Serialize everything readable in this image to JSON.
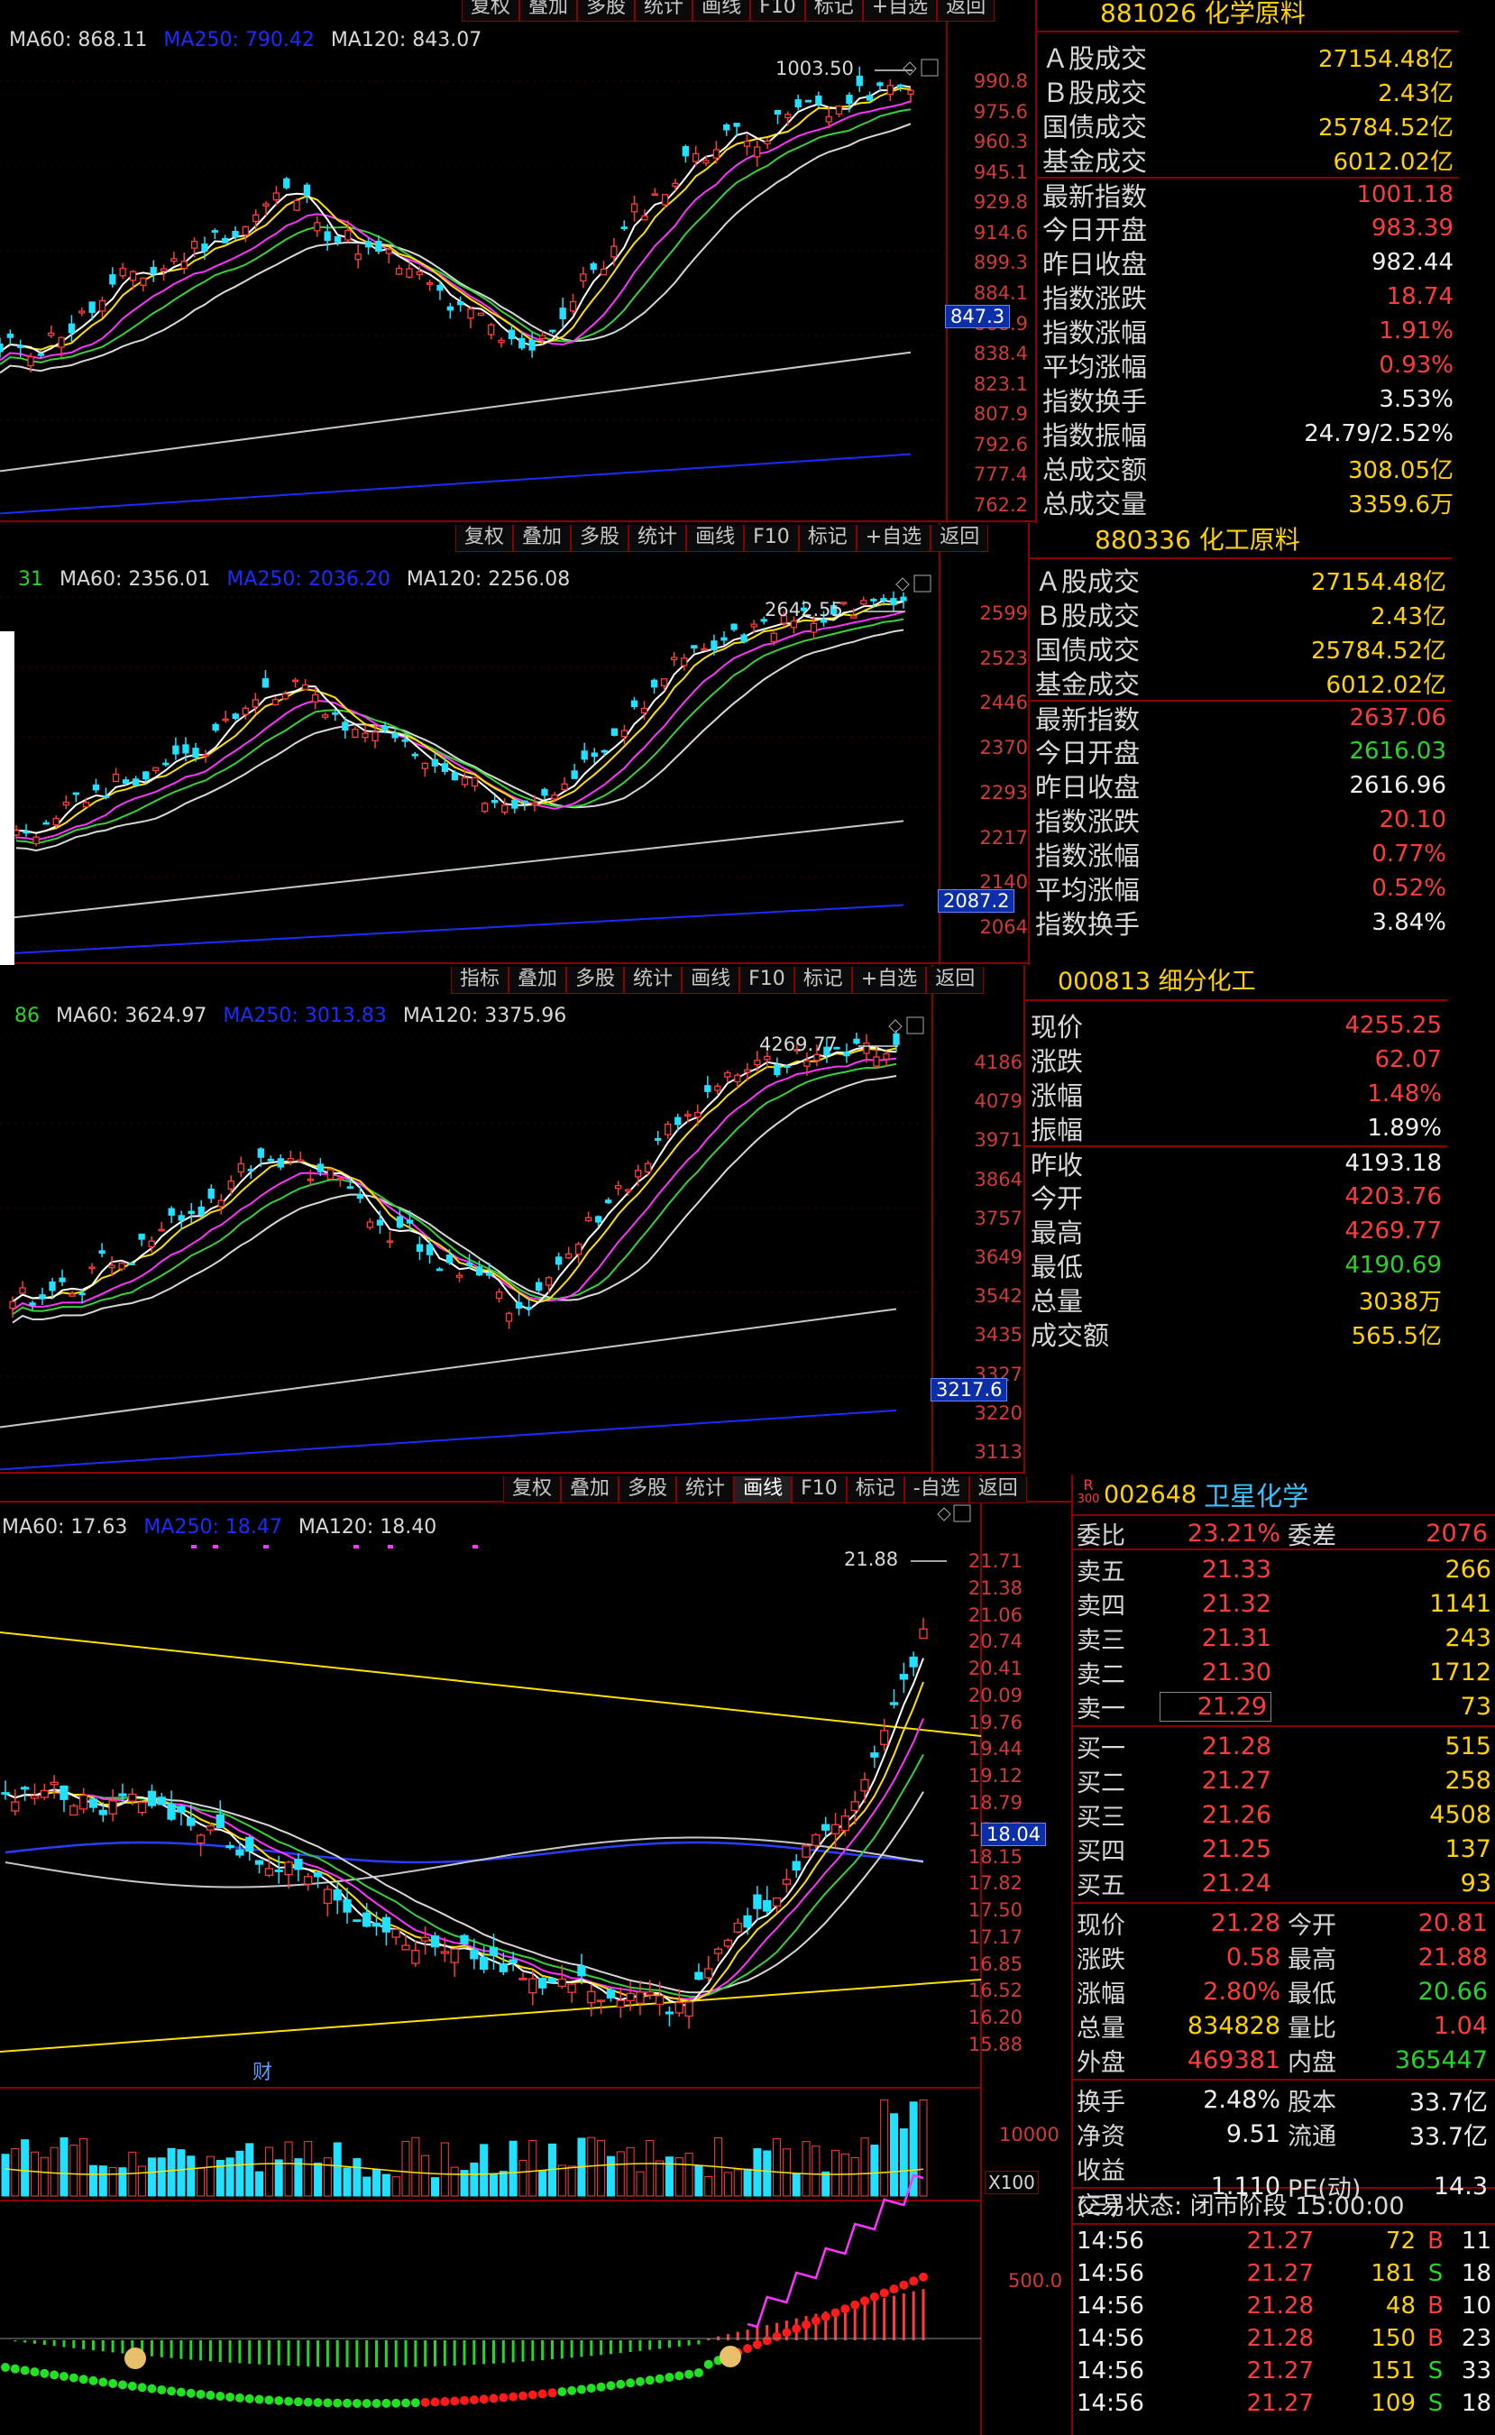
{
  "colors": {
    "up": "#ff3c3c",
    "down": "#22e0ff",
    "ma5": "#ffffff",
    "ma10": "#ffe100",
    "ma20": "#ff33ff",
    "ma30": "#39d039",
    "ma60": "#d8d8d8",
    "ma250": "#1c2cff",
    "ma120": "#c8c8c8",
    "grid": "#8a0000"
  },
  "panels": [
    {
      "toolbar": [
        "复权",
        "叠加",
        "多股",
        "统计",
        "画线",
        "F10",
        "标记",
        "+自选",
        "返回"
      ],
      "ma_labels": [
        "MA60: 868.11",
        "MA250: 790.42",
        "MA120: 843.07"
      ],
      "y_ticks": [
        "990.8",
        "975.6",
        "960.3",
        "945.1",
        "929.8",
        "914.6",
        "899.3",
        "884.1",
        "868.9",
        "838.4",
        "823.1",
        "807.9",
        "792.6",
        "777.4",
        "762.2"
      ],
      "current_tag": "847.3",
      "high_label": "1003.50",
      "info_title_code": "881026",
      "info_title_name": "化学原料",
      "rows": [
        {
          "k": "Ａ股成交",
          "v": "27154.48亿",
          "c": "y"
        },
        {
          "k": "Ｂ股成交",
          "v": "2.43亿",
          "c": "y"
        },
        {
          "k": "国债成交",
          "v": "25784.52亿",
          "c": "y"
        },
        {
          "k": "基金成交",
          "v": "6012.02亿",
          "c": "y"
        },
        {
          "k": "最新指数",
          "v": "1001.18",
          "c": "r",
          "sep": true
        },
        {
          "k": "今日开盘",
          "v": "983.39",
          "c": "r"
        },
        {
          "k": "昨日收盘",
          "v": "982.44",
          "c": "w"
        },
        {
          "k": "指数涨跌",
          "v": "18.74",
          "c": "r"
        },
        {
          "k": "指数涨幅",
          "v": "1.91%",
          "c": "r"
        },
        {
          "k": "平均涨幅",
          "v": "0.93%",
          "c": "r"
        },
        {
          "k": "指数换手",
          "v": "3.53%",
          "c": "w"
        },
        {
          "k": "指数振幅",
          "v": "24.79/2.52%",
          "c": "w"
        },
        {
          "k": "总成交额",
          "v": "308.05亿",
          "c": "y"
        },
        {
          "k": "总成交量",
          "v": "3359.6万",
          "c": "y"
        }
      ]
    },
    {
      "toolbar": [
        "复权",
        "叠加",
        "多股",
        "统计",
        "画线",
        "F10",
        "标记",
        "+自选",
        "返回"
      ],
      "ma_labels": [
        "31",
        "MA60: 2356.01",
        "MA250: 2036.20",
        "MA120: 2256.08"
      ],
      "y_ticks": [
        "2599",
        "2523",
        "2446",
        "2370",
        "2293",
        "2217",
        "2140",
        "2064"
      ],
      "current_tag": "2087.2",
      "high_label": "2642.55",
      "info_title_code": "880336",
      "info_title_name": "化工原料",
      "rows": [
        {
          "k": "Ａ股成交",
          "v": "27154.48亿",
          "c": "y"
        },
        {
          "k": "Ｂ股成交",
          "v": "2.43亿",
          "c": "y"
        },
        {
          "k": "国债成交",
          "v": "25784.52亿",
          "c": "y"
        },
        {
          "k": "基金成交",
          "v": "6012.02亿",
          "c": "y"
        },
        {
          "k": "最新指数",
          "v": "2637.06",
          "c": "r",
          "sep": true
        },
        {
          "k": "今日开盘",
          "v": "2616.03",
          "c": "g"
        },
        {
          "k": "昨日收盘",
          "v": "2616.96",
          "c": "w"
        },
        {
          "k": "指数涨跌",
          "v": "20.10",
          "c": "r"
        },
        {
          "k": "指数涨幅",
          "v": "0.77%",
          "c": "r"
        },
        {
          "k": "平均涨幅",
          "v": "0.52%",
          "c": "r"
        },
        {
          "k": "指数换手",
          "v": "3.84%",
          "c": "w"
        }
      ]
    },
    {
      "toolbar": [
        "指标",
        "叠加",
        "多股",
        "统计",
        "画线",
        "F10",
        "标记",
        "+自选",
        "返回"
      ],
      "ma_labels": [
        "86",
        "MA60: 3624.97",
        "MA250: 3013.83",
        "MA120: 3375.96"
      ],
      "y_ticks": [
        "4186",
        "4079",
        "3971",
        "3864",
        "3757",
        "3649",
        "3542",
        "3435",
        "3327",
        "3220",
        "3113"
      ],
      "current_tag": "3217.6",
      "high_label": "4269.77",
      "info_title_code": "000813",
      "info_title_name": "细分化工",
      "rows": [
        {
          "k": "现价",
          "v": "4255.25",
          "c": "r"
        },
        {
          "k": "涨跌",
          "v": "62.07",
          "c": "r"
        },
        {
          "k": "涨幅",
          "v": "1.48%",
          "c": "r"
        },
        {
          "k": "振幅",
          "v": "1.89%",
          "c": "w"
        },
        {
          "k": "昨收",
          "v": "4193.18",
          "c": "w",
          "sep": true
        },
        {
          "k": "今开",
          "v": "4203.76",
          "c": "r"
        },
        {
          "k": "最高",
          "v": "4269.77",
          "c": "r"
        },
        {
          "k": "最低",
          "v": "4190.69",
          "c": "g"
        },
        {
          "k": "总量",
          "v": "3038万",
          "c": "y"
        },
        {
          "k": "成交额",
          "v": "565.5亿",
          "c": "y"
        }
      ]
    }
  ],
  "stock": {
    "toolbar": [
      "复权",
      "叠加",
      "多股",
      "统计",
      "画线",
      "F10",
      "标记",
      "-自选",
      "返回"
    ],
    "ma_labels": [
      "MA60: 17.63",
      "MA250: 18.47",
      "MA120: 18.40"
    ],
    "y_ticks": [
      "21.71",
      "21.38",
      "21.06",
      "20.74",
      "20.41",
      "20.09",
      "19.76",
      "19.44",
      "19.12",
      "18.79",
      "18.47",
      "18.15",
      "17.82",
      "17.50",
      "17.17",
      "16.85",
      "16.52",
      "16.20",
      "15.88"
    ],
    "current_tag": "18.04",
    "high_label": "21.88",
    "cai_label": "财",
    "vol_tick": "10000",
    "vol_unit": "X100",
    "macd_tick": "500.0",
    "badge": "R",
    "badge_sub": "300",
    "code": "002648",
    "name": "卫星化学",
    "weibi_k": "委比",
    "weibi_v": "23.21%",
    "weicha_k": "委差",
    "weicha_v": "2076",
    "asks": [
      {
        "k": "卖五",
        "p": "21.33",
        "v": "266"
      },
      {
        "k": "卖四",
        "p": "21.32",
        "v": "1141"
      },
      {
        "k": "卖三",
        "p": "21.31",
        "v": "243"
      },
      {
        "k": "卖二",
        "p": "21.30",
        "v": "1712"
      },
      {
        "k": "卖一",
        "p": "21.29",
        "v": "73"
      }
    ],
    "bids": [
      {
        "k": "买一",
        "p": "21.28",
        "v": "515"
      },
      {
        "k": "买二",
        "p": "21.27",
        "v": "258"
      },
      {
        "k": "买三",
        "p": "21.26",
        "v": "4508"
      },
      {
        "k": "买四",
        "p": "21.25",
        "v": "137"
      },
      {
        "k": "买五",
        "p": "21.24",
        "v": "93"
      }
    ],
    "stats": [
      {
        "k1": "现价",
        "v1": "21.28",
        "c1": "r",
        "k2": "今开",
        "v2": "20.81",
        "c2": "r"
      },
      {
        "k1": "涨跌",
        "v1": "0.58",
        "c1": "r",
        "k2": "最高",
        "v2": "21.88",
        "c2": "r"
      },
      {
        "k1": "涨幅",
        "v1": "2.80%",
        "c1": "r",
        "k2": "最低",
        "v2": "20.66",
        "c2": "g"
      },
      {
        "k1": "总量",
        "v1": "834828",
        "c1": "y",
        "k2": "量比",
        "v2": "1.04",
        "c2": "r"
      },
      {
        "k1": "外盘",
        "v1": "469381",
        "c1": "r",
        "k2": "内盘",
        "v2": "365447",
        "c2": "g"
      }
    ],
    "stats2": [
      {
        "k1": "换手",
        "v1": "2.48%",
        "c1": "w",
        "k2": "股本",
        "v2": "33.7亿",
        "c2": "w"
      },
      {
        "k1": "净资",
        "v1": "9.51",
        "c1": "w",
        "k2": "流通",
        "v2": "33.7亿",
        "c2": "w"
      },
      {
        "k1": "收益(三)",
        "v1": "1.110",
        "c1": "w",
        "k2": "PE(动)",
        "v2": "14.3",
        "c2": "w"
      }
    ],
    "trade_status": "交易状态: 闭市阶段 15:00:00",
    "ticks": [
      {
        "t": "14:56",
        "p": "21.27",
        "v": "72",
        "s": "B",
        "n": "11"
      },
      {
        "t": "14:56",
        "p": "21.27",
        "v": "181",
        "s": "S",
        "n": "18"
      },
      {
        "t": "14:56",
        "p": "21.28",
        "v": "48",
        "s": "B",
        "n": "10"
      },
      {
        "t": "14:56",
        "p": "21.28",
        "v": "150",
        "s": "B",
        "n": "23"
      },
      {
        "t": "14:56",
        "p": "21.27",
        "v": "151",
        "s": "S",
        "n": "33"
      },
      {
        "t": "14:56",
        "p": "21.27",
        "v": "109",
        "s": "S",
        "n": "18"
      }
    ]
  }
}
